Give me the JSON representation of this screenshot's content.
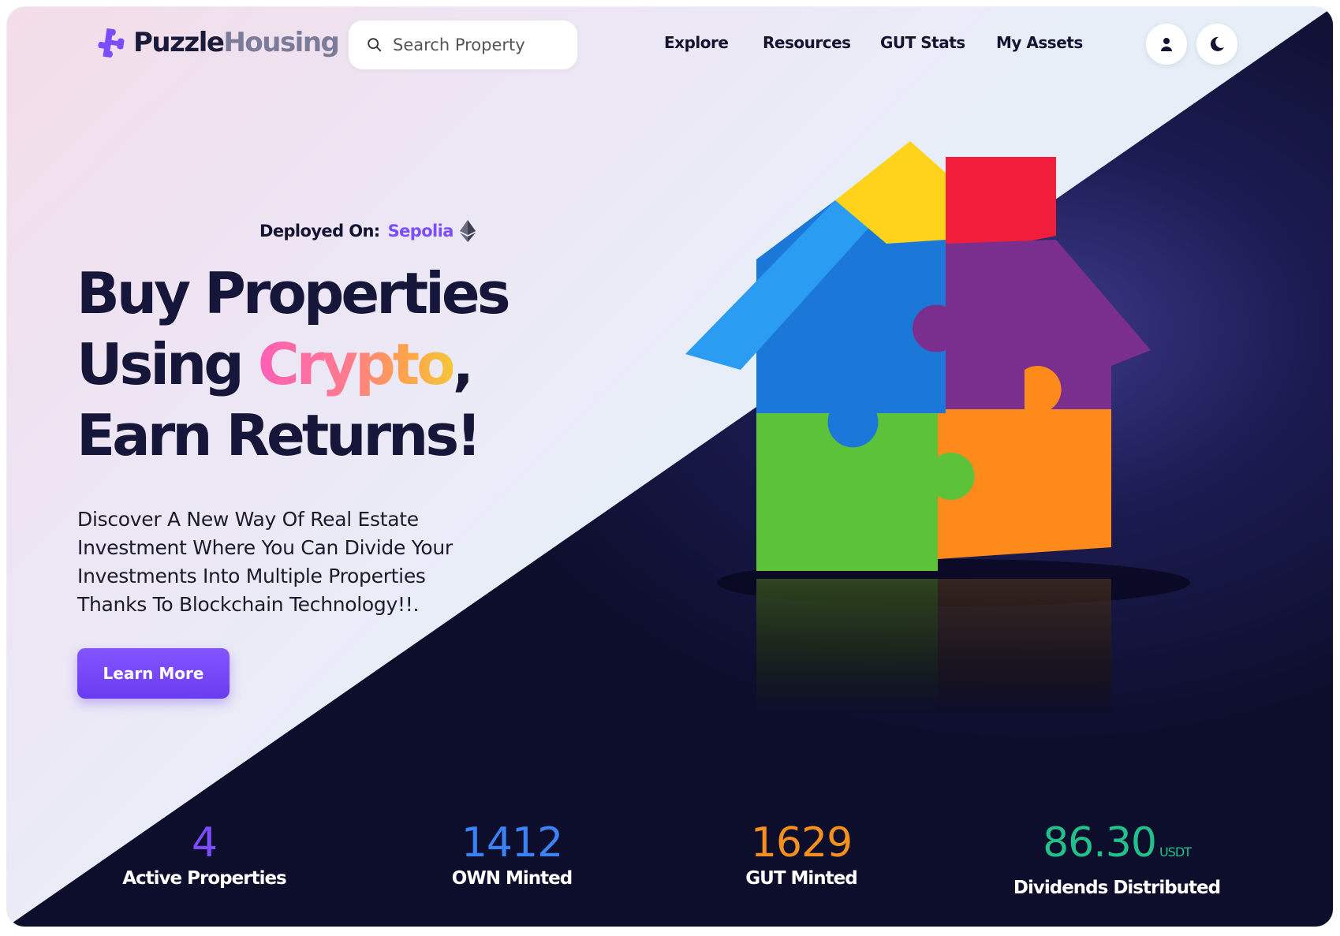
{
  "brand": {
    "name_a": "Puzzle",
    "name_b": "Housing"
  },
  "search": {
    "placeholder": "Search Property",
    "value": ""
  },
  "nav": {
    "items": [
      {
        "label": "Explore"
      },
      {
        "label": "Resources"
      },
      {
        "label": "GUT Stats"
      },
      {
        "label": "My Assets"
      }
    ]
  },
  "actions": {
    "account_icon": "user-icon",
    "theme_icon": "moon-icon"
  },
  "hero": {
    "deployed_label": "Deployed On:",
    "network": "Sepolia",
    "network_icon": "ethereum-icon",
    "headline_1": "Buy Properties",
    "headline_2a": "Using ",
    "headline_2b": "Crypto",
    "headline_2c": ",",
    "headline_3": "Earn Returns!",
    "description": "Discover A New Way Of Real Estate Investment Where You Can Divide Your Investments Into Multiple Properties Thanks To Blockchain Technology!!.",
    "cta": "Learn More"
  },
  "stats": [
    {
      "value": "4",
      "unit": "",
      "label": "Active Properties",
      "color": "#7b4dff"
    },
    {
      "value": "1412",
      "unit": "",
      "label": "OWN Minted",
      "color": "#3b82f6"
    },
    {
      "value": "1629",
      "unit": "",
      "label": "GUT Minted",
      "color": "#f5901e"
    },
    {
      "value": "86.30",
      "unit": "USDT",
      "label": "Dividends Distributed",
      "color": "#22c08a"
    }
  ],
  "colors": {
    "accent": "#7b4dff",
    "dark_bg": "#0d0e2c",
    "text": "#141432"
  }
}
